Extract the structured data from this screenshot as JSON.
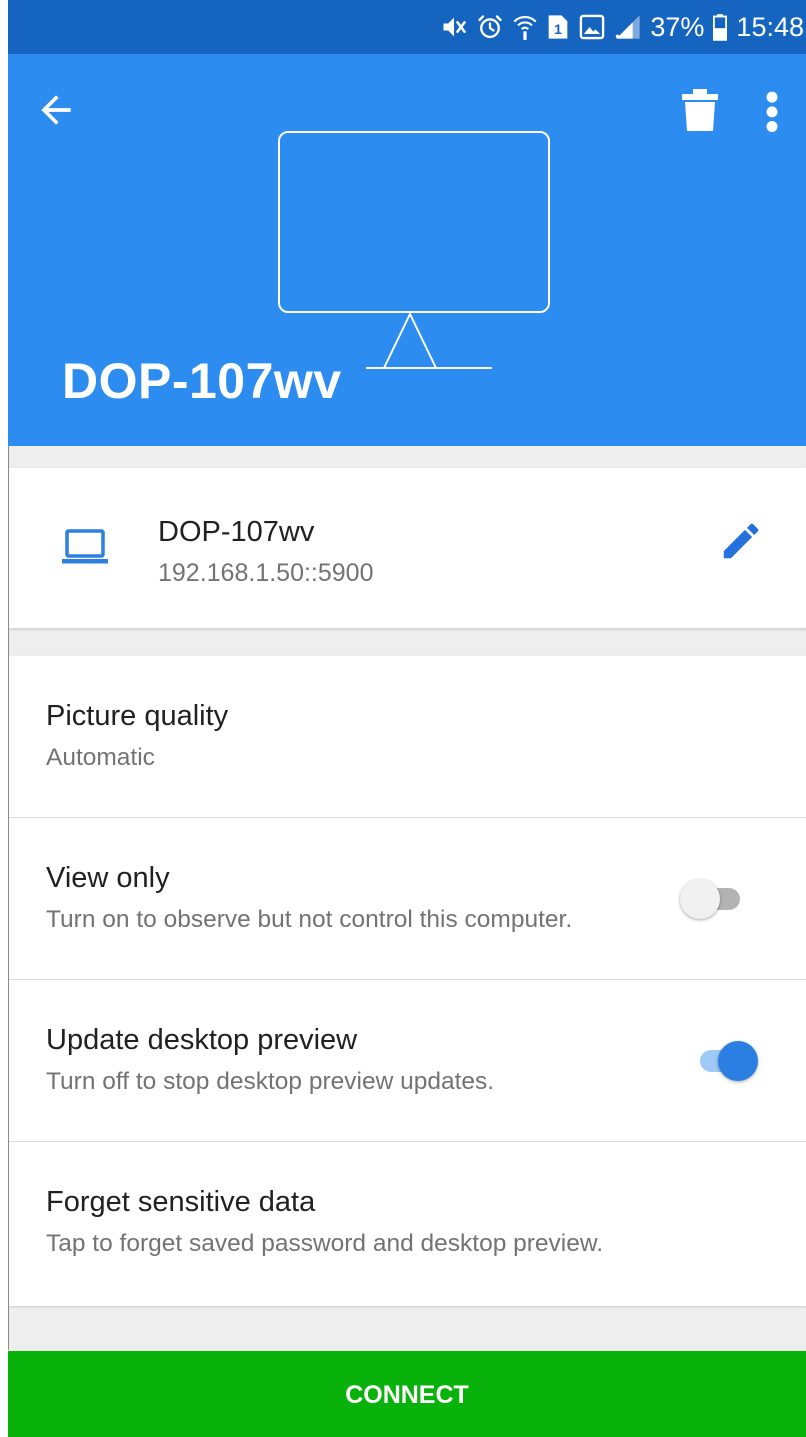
{
  "status_bar": {
    "battery_percent": "37%",
    "time": "15:48",
    "sim_label": "1"
  },
  "header": {
    "device_title": "DOP-107wv"
  },
  "device": {
    "name": "DOP-107wv",
    "address": "192.168.1.50::5900"
  },
  "settings": {
    "picture_quality": {
      "title": "Picture quality",
      "value": "Automatic"
    },
    "view_only": {
      "title": "View only",
      "subtitle": "Turn on to observe but not control this computer.",
      "enabled": false
    },
    "update_preview": {
      "title": "Update desktop preview",
      "subtitle": "Turn off to stop desktop preview updates.",
      "enabled": true
    },
    "forget_data": {
      "title": "Forget sensitive data",
      "subtitle": "Tap to forget saved password and desktop preview."
    }
  },
  "actions": {
    "connect_label": "CONNECT"
  },
  "colors": {
    "status_bar": "#1565c0",
    "header": "#2d8cf0",
    "accent_blue": "#2b7fe3",
    "connect_green": "#09b20b"
  },
  "icons": [
    "mute-icon",
    "alarm-icon",
    "wifi-calling-icon",
    "sim-icon",
    "gallery-icon",
    "signal-icon",
    "battery-icon",
    "back-arrow-icon",
    "trash-icon",
    "more-vert-icon",
    "laptop-icon",
    "edit-icon"
  ]
}
